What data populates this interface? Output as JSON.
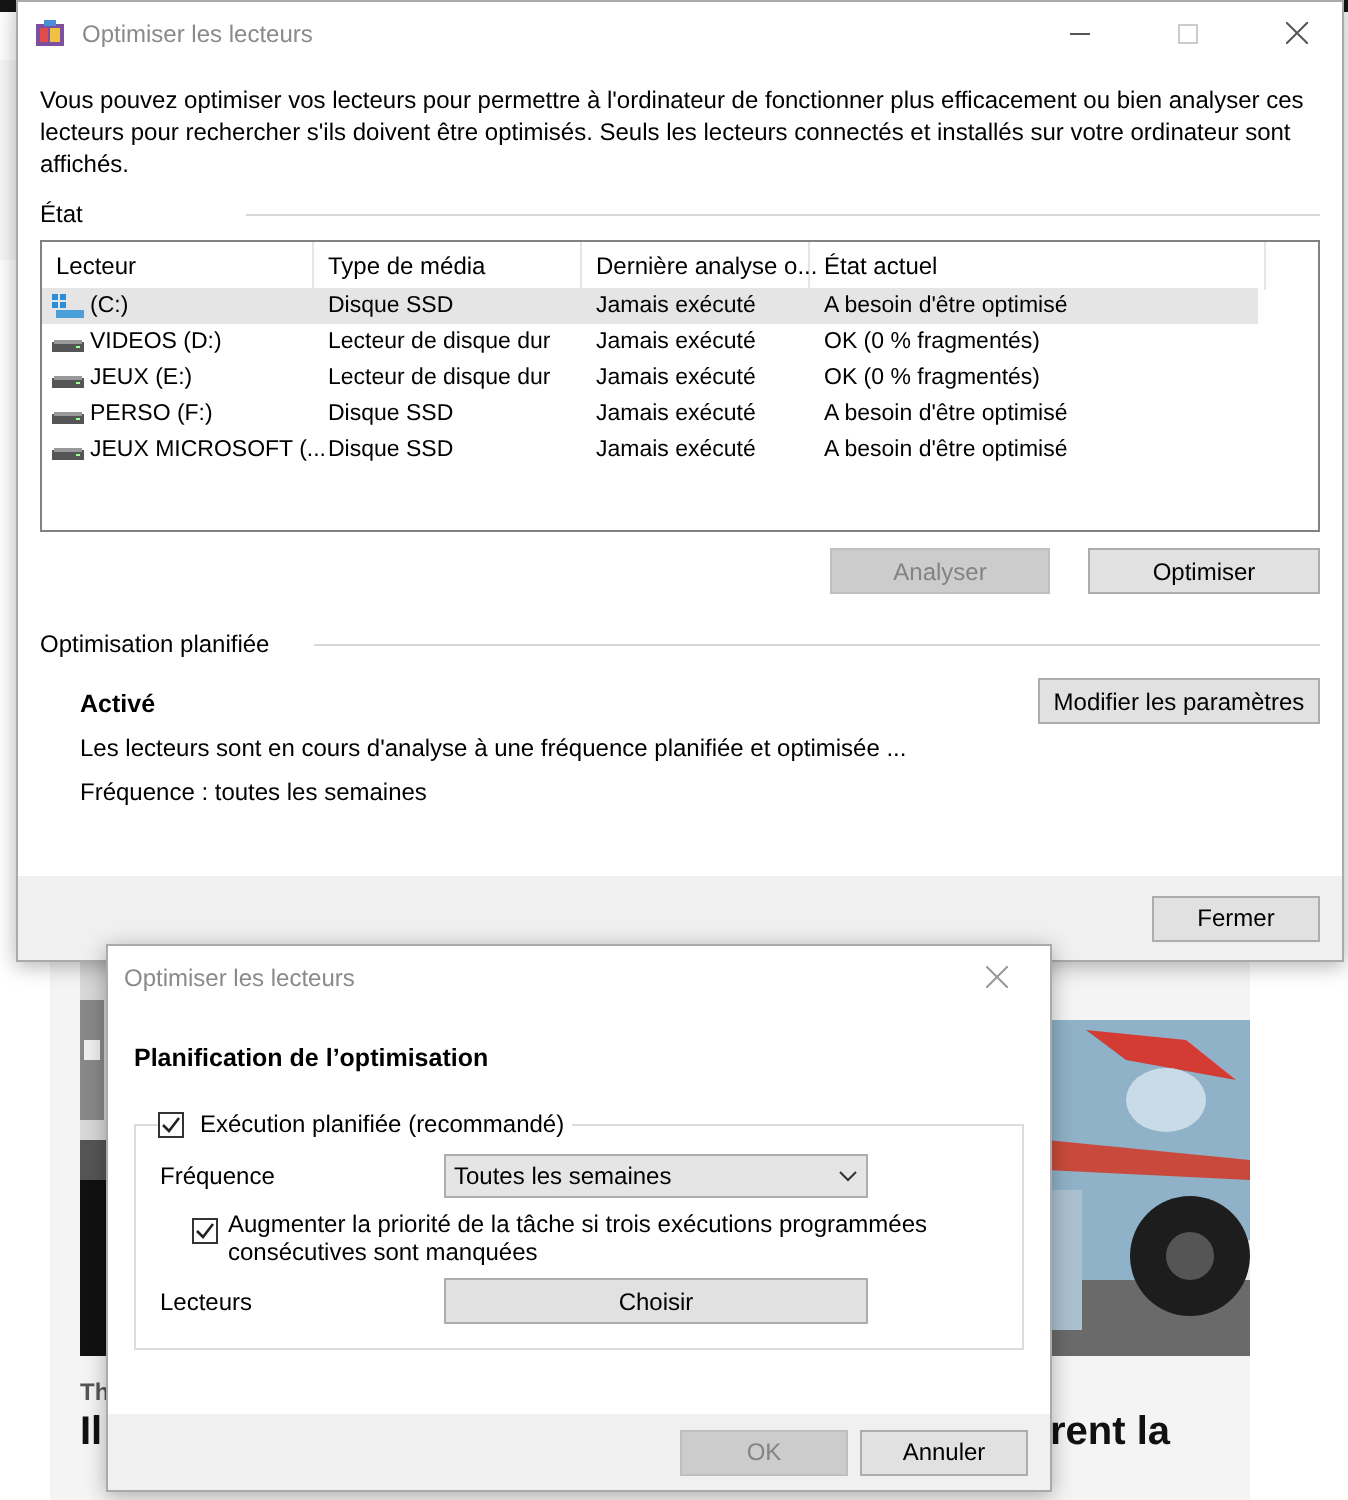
{
  "background": {
    "fragments": [
      {
        "text": "Th"
      },
      {
        "text": "Il"
      },
      {
        "text": "rent la"
      }
    ]
  },
  "main_window": {
    "title": "Optimiser les lecteurs",
    "description": "Vous pouvez optimiser vos lecteurs pour permettre à l'ordinateur de fonctionner plus efficacement ou bien analyser ces lecteurs pour rechercher s'ils doivent être optimisés. Seuls les lecteurs connectés et installés sur votre ordinateur sont affichés.",
    "status_group": "État",
    "table": {
      "columns": [
        "Lecteur",
        "Type de média",
        "Dernière analyse o...",
        "État actuel"
      ],
      "rows": [
        {
          "kind": "system",
          "selected": true,
          "cells": [
            "(C:)",
            "Disque SSD",
            "Jamais exécuté",
            "A besoin d'être optimisé"
          ]
        },
        {
          "kind": "drive",
          "selected": false,
          "cells": [
            "VIDEOS (D:)",
            "Lecteur de disque dur",
            "Jamais exécuté",
            "OK (0 % fragmentés)"
          ]
        },
        {
          "kind": "drive",
          "selected": false,
          "cells": [
            "JEUX (E:)",
            "Lecteur de disque dur",
            "Jamais exécuté",
            "OK (0 % fragmentés)"
          ]
        },
        {
          "kind": "drive",
          "selected": false,
          "cells": [
            "PERSO (F:)",
            "Disque SSD",
            "Jamais exécuté",
            "A besoin d'être optimisé"
          ]
        },
        {
          "kind": "drive",
          "selected": false,
          "cells": [
            "JEUX MICROSOFT (...",
            "Disque SSD",
            "Jamais exécuté",
            "A besoin d'être optimisé"
          ]
        }
      ]
    },
    "buttons": [
      {
        "label": "Analyser",
        "disabled": true
      },
      {
        "label": "Optimiser",
        "disabled": false
      }
    ],
    "schedule_group": "Optimisation planifiée",
    "schedule_status": "Activé",
    "schedule_button": "Modifier les paramètres",
    "schedule_description": "Les lecteurs sont en cours d'analyse à une fréquence planifiée et optimisée ...",
    "schedule_frequency": "Fréquence : toutes les semaines",
    "close_button": "Fermer"
  },
  "schedule_dialog": {
    "title": "Optimiser les lecteurs",
    "heading": "Planification de l’optimisation",
    "scheduled_run": {
      "label": "Exécution planifiée (recommandé)",
      "checked": true
    },
    "frequency_label": "Fréquence",
    "frequency_value": "Toutes les semaines",
    "priority": {
      "label": "Augmenter la priorité de la tâche si trois exécutions programmées consécutives sont manquées",
      "checked": true
    },
    "drives_label": "Lecteurs",
    "choose_button": "Choisir",
    "buttons": [
      {
        "label": "OK",
        "disabled": true
      },
      {
        "label": "Annuler",
        "disabled": false
      }
    ]
  }
}
